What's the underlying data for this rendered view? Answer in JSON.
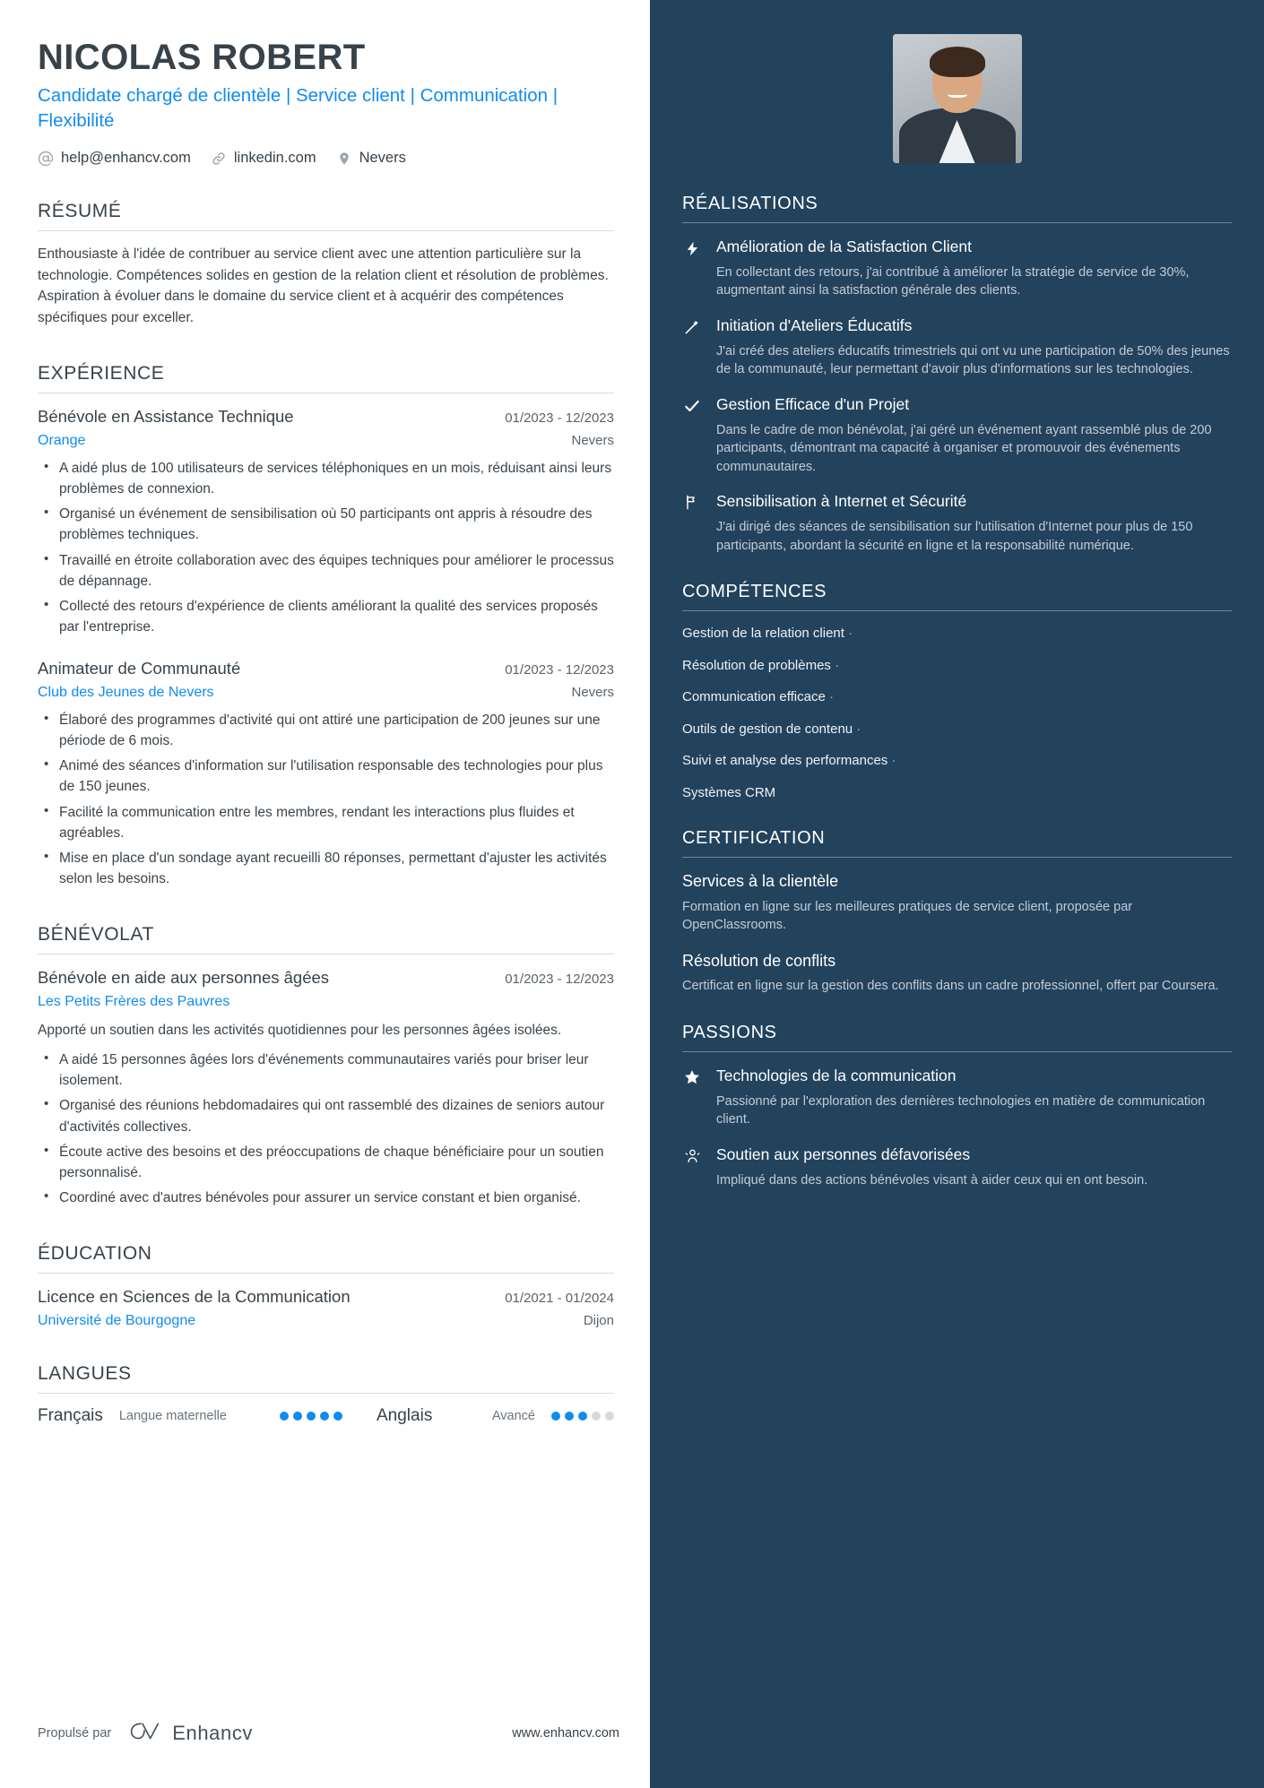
{
  "header": {
    "name": "NICOLAS ROBERT",
    "headline": "Candidate chargé de clientèle | Service client | Communication | Flexibilité",
    "contacts": [
      {
        "icon": "at-icon",
        "label": "help@enhancv.com"
      },
      {
        "icon": "link-icon",
        "label": "linkedin.com"
      },
      {
        "icon": "location-pin-icon",
        "label": "Nevers"
      }
    ]
  },
  "summary": {
    "title": "RÉSUMÉ",
    "text": "Enthousiaste à l'idée de contribuer au service client avec une attention particulière sur la technologie. Compétences solides en gestion de la relation client et résolution de problèmes. Aspiration à évoluer dans le domaine du service client et à acquérir des compétences spécifiques pour exceller."
  },
  "experience": {
    "title": "EXPÉRIENCE",
    "entries": [
      {
        "role": "Bénévole en Assistance Technique",
        "date": "01/2023 - 12/2023",
        "org": "Orange",
        "location": "Nevers",
        "bullets": [
          "A aidé plus de 100 utilisateurs de services téléphoniques en un mois, réduisant ainsi leurs problèmes de connexion.",
          "Organisé un événement de sensibilisation où 50 participants ont appris à résoudre des problèmes techniques.",
          "Travaillé en étroite collaboration avec des équipes techniques pour améliorer le processus de dépannage.",
          "Collecté des retours d'expérience de clients améliorant la qualité des services proposés par l'entreprise."
        ]
      },
      {
        "role": "Animateur de Communauté",
        "date": "01/2023 - 12/2023",
        "org": "Club des Jeunes de Nevers",
        "location": "Nevers",
        "bullets": [
          "Élaboré des programmes d'activité qui ont attiré une participation de 200 jeunes sur une période de 6 mois.",
          "Animé des séances d'information sur l'utilisation responsable des technologies pour plus de 150 jeunes.",
          "Facilité la communication entre les membres, rendant les interactions plus fluides et agréables.",
          "Mise en place d'un sondage ayant recueilli 80 réponses, permettant d'ajuster les activités selon les besoins."
        ]
      }
    ]
  },
  "volunteering": {
    "title": "BÉNÉVOLAT",
    "entries": [
      {
        "role": "Bénévole en aide aux personnes âgées",
        "date": "01/2023 - 12/2023",
        "org": "Les Petits Frères des Pauvres",
        "location": "",
        "desc": "Apporté un soutien dans les activités quotidiennes pour les personnes âgées isolées.",
        "bullets": [
          "A aidé 15 personnes âgées lors d'événements communautaires variés pour briser leur isolement.",
          "Organisé des réunions hebdomadaires qui ont rassemblé des dizaines de seniors autour d'activités collectives.",
          "Écoute active des besoins et des préoccupations de chaque bénéficiaire pour un soutien personnalisé.",
          "Coordiné avec d'autres bénévoles pour assurer un service constant et bien organisé."
        ]
      }
    ]
  },
  "education": {
    "title": "ÉDUCATION",
    "entries": [
      {
        "degree": "Licence en Sciences de la Communication",
        "date": "01/2021 - 01/2024",
        "school": "Université de Bourgogne",
        "location": "Dijon"
      }
    ]
  },
  "languages": {
    "title": "LANGUES",
    "items": [
      {
        "name": "Français",
        "level": "Langue maternelle",
        "dots_filled": 5,
        "dots_total": 5
      },
      {
        "name": "Anglais",
        "level": "Avancé",
        "dots_filled": 3,
        "dots_total": 5
      }
    ]
  },
  "footer": {
    "powered_by": "Propulsé par",
    "brand": "Enhancv",
    "brand_icon": "enhancv-logo-icon",
    "url": "www.enhancv.com"
  },
  "sidebar": {
    "photo_alt": "profile-photo",
    "achievements": {
      "title": "RÉALISATIONS",
      "items": [
        {
          "icon": "lightning-bolt-icon",
          "title": "Amélioration de la Satisfaction Client",
          "desc": "En collectant des retours, j'ai contribué à améliorer la stratégie de service de 30%, augmentant ainsi la satisfaction générale des clients."
        },
        {
          "icon": "magic-wand-icon",
          "title": "Initiation d'Ateliers Éducatifs",
          "desc": "J'ai créé des ateliers éducatifs trimestriels qui ont vu une participation de 50% des jeunes de la communauté, leur permettant d'avoir plus d'informations sur les technologies."
        },
        {
          "icon": "check-icon",
          "title": "Gestion Efficace d'un Projet",
          "desc": "Dans le cadre de mon bénévolat, j'ai géré un événement ayant rassemblé plus de 200 participants, démontrant ma capacité à organiser et promouvoir des événements communautaires."
        },
        {
          "icon": "flag-icon",
          "title": "Sensibilisation à Internet et Sécurité",
          "desc": "J'ai dirigé des séances de sensibilisation sur l'utilisation d'Internet pour plus de 150 participants, abordant la sécurité en ligne et la responsabilité numérique."
        }
      ]
    },
    "skills": {
      "title": "COMPÉTENCES",
      "items": [
        {
          "label": "Gestion de la relation client",
          "sep": "·"
        },
        {
          "label": "Résolution de problèmes",
          "sep": "·"
        },
        {
          "label": "Communication efficace",
          "sep": "·"
        },
        {
          "label": "Outils de gestion de contenu",
          "sep": "·"
        },
        {
          "label": "Suivi et analyse des performances",
          "sep": "·"
        },
        {
          "label": "Systèmes CRM",
          "sep": ""
        }
      ]
    },
    "certification": {
      "title": "CERTIFICATION",
      "items": [
        {
          "title": "Services à la clientèle",
          "desc": "Formation en ligne sur les meilleures pratiques de service client, proposée par OpenClassrooms."
        },
        {
          "title": "Résolution de conflits",
          "desc": "Certificat en ligne sur la gestion des conflits dans un cadre professionnel, offert par Coursera."
        }
      ]
    },
    "passions": {
      "title": "PASSIONS",
      "items": [
        {
          "icon": "star-icon",
          "title": "Technologies de la communication",
          "desc": "Passionné par l'exploration des dernières technologies en matière de communication client."
        },
        {
          "icon": "people-support-icon",
          "title": "Soutien aux personnes défavorisées",
          "desc": "Impliqué dans des actions bénévoles visant à aider ceux qui en ont besoin."
        }
      ]
    }
  },
  "colors": {
    "accent_blue": "#0f8cf0",
    "sidebar_bg": "#23435d",
    "text_dark": "#37424a",
    "muted": "#c1ccd6"
  }
}
